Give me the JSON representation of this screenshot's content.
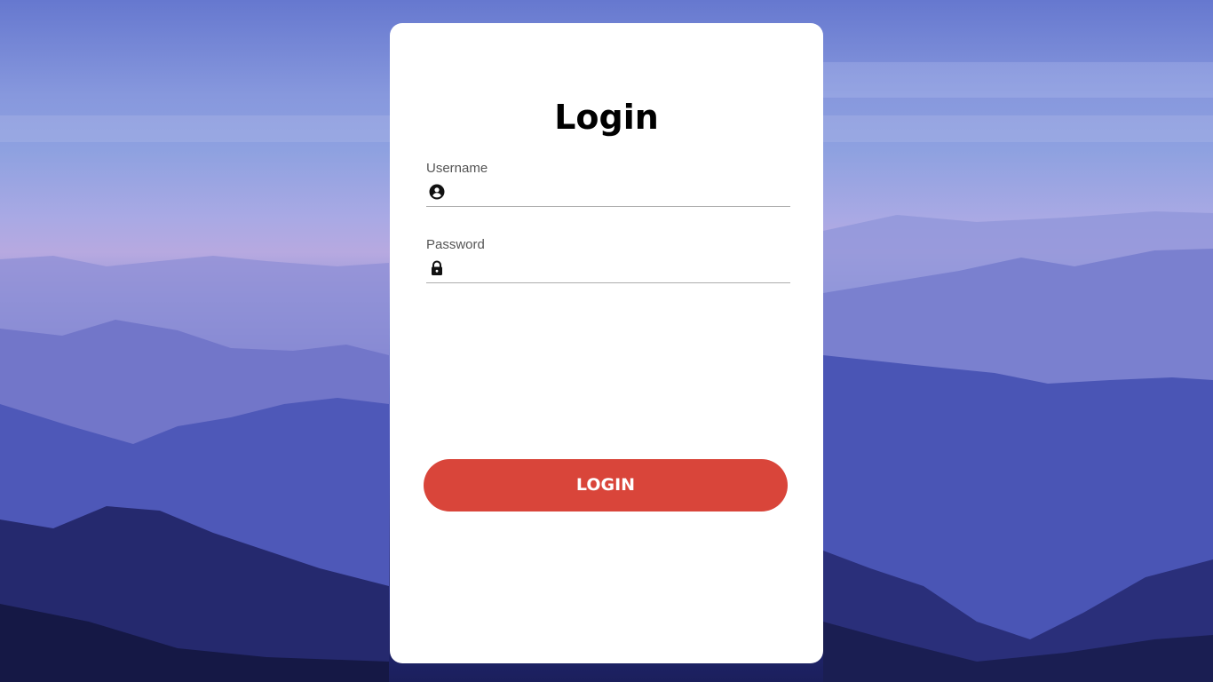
{
  "page": {
    "title": "Login"
  },
  "username": {
    "label": "Username",
    "value": "",
    "placeholder": "",
    "icon": "user-circle-icon"
  },
  "password": {
    "label": "Password",
    "value": "",
    "placeholder": "",
    "icon": "lock-icon"
  },
  "actions": {
    "login_label": "LOGIN"
  },
  "colors": {
    "button": "#d9453a",
    "card": "#ffffff",
    "background_top": "#6678cf",
    "background_bottom": "#1b1f5c"
  }
}
